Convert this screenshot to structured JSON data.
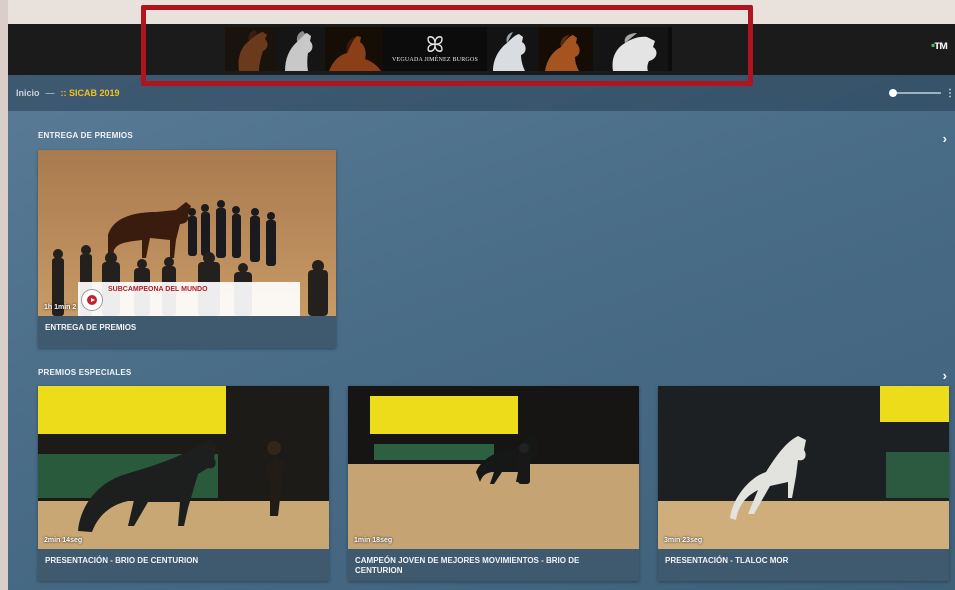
{
  "header": {
    "banner_brand": "VEGUADA JIMÉNEZ BURGOS",
    "banner_monogram": "ꕤ",
    "app_logo": "ᴛᴍ"
  },
  "breadcrumb": {
    "home": "Inicio",
    "separator": "—",
    "current": ":: SICAB 2019"
  },
  "colors": {
    "accent": "#f2c31c",
    "highlight_box": "#b0141e",
    "brand_green": "#3ec65a"
  },
  "sections": [
    {
      "title": "ENTREGA DE PREMIOS",
      "arrow": "›",
      "items": [
        {
          "duration": "1h 1min 2",
          "title": "ENTREGA DE PREMIOS",
          "lower_third": "SUBCAMPEONA DEL MUNDO"
        }
      ]
    },
    {
      "title": "PREMIOS ESPECIALES",
      "arrow": "›",
      "items": [
        {
          "duration": "2min 14seg",
          "title": "PRESENTACIÓN - BRIO DE CENTURION"
        },
        {
          "duration": "1min 18seg",
          "title": "CAMPEÓN JOVEN DE MEJORES MOVIMIENTOS - BRIO DE CENTURION"
        },
        {
          "duration": "3min 23seg",
          "title": "PRESENTACIÓN - TLALOC MOR"
        }
      ]
    }
  ]
}
